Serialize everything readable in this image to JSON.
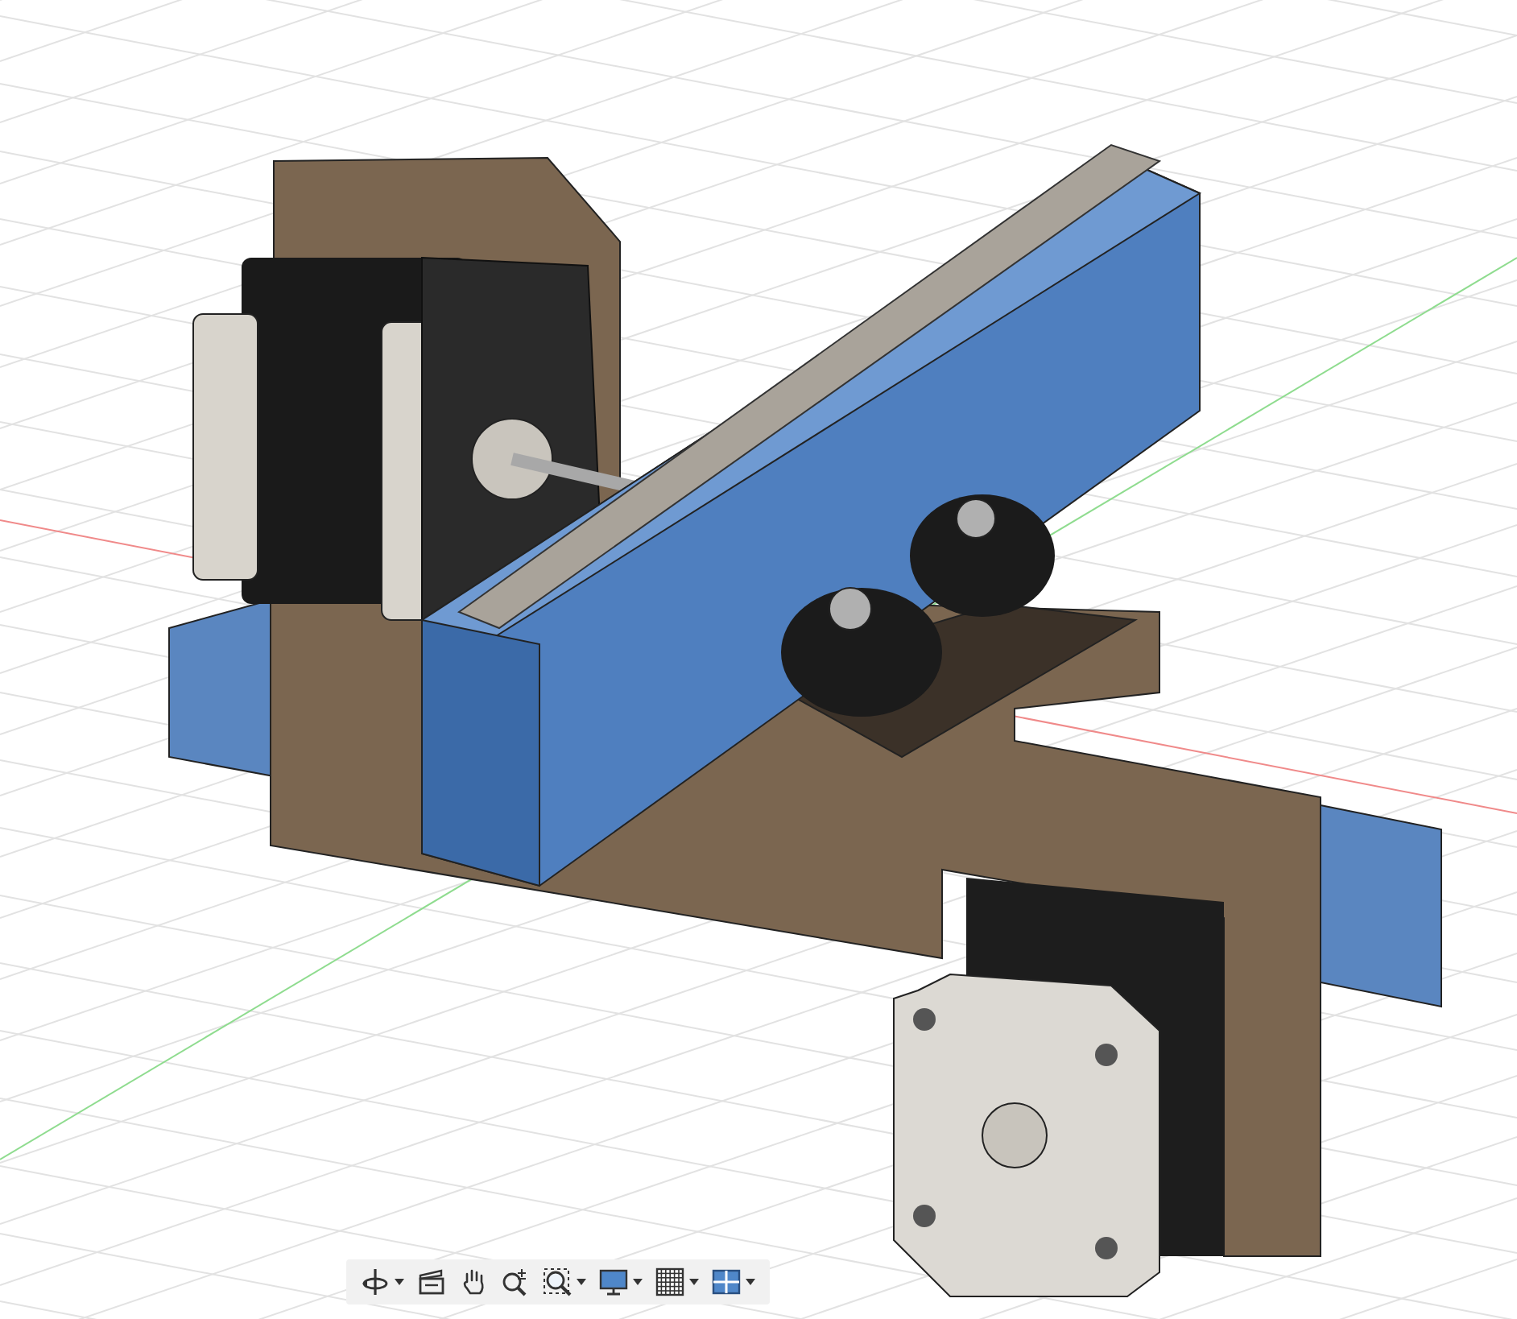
{
  "toolbar": [
    {
      "kind": "orbit",
      "has_menu": true
    },
    {
      "kind": "look_at",
      "has_menu": false
    },
    {
      "kind": "pan",
      "has_menu": false
    },
    {
      "kind": "zoom",
      "has_menu": false
    },
    {
      "kind": "fit",
      "has_menu": true
    },
    {
      "kind": "display",
      "has_menu": true
    },
    {
      "kind": "grid",
      "has_menu": true
    },
    {
      "kind": "viewports",
      "has_menu": true
    }
  ]
}
